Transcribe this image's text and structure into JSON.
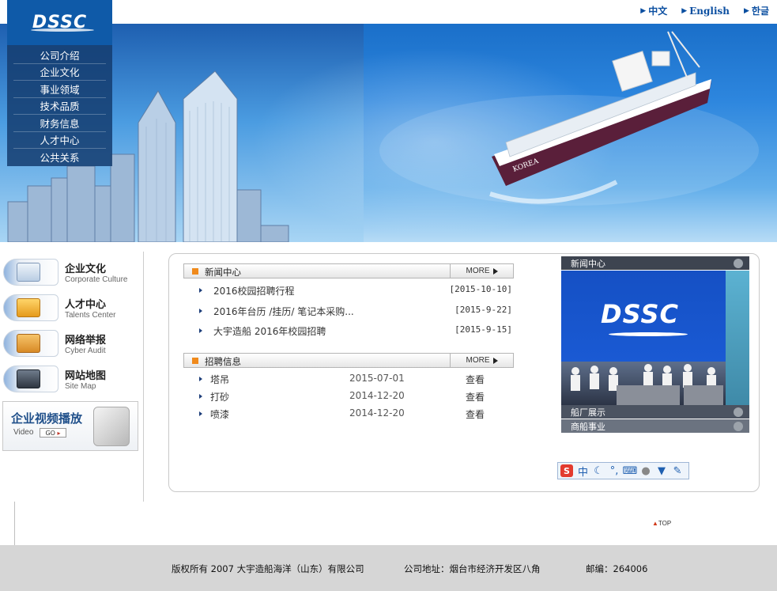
{
  "languages": [
    "中文",
    "English",
    "한글"
  ],
  "logo": {
    "text": "DSSC"
  },
  "nav": [
    "公司介绍",
    "企业文化",
    "事业领域",
    "技术品质",
    "财务信息",
    "人才中心",
    "公共关系"
  ],
  "side_links": [
    {
      "title": "企业文化",
      "subtitle": "Corporate Culture",
      "icon": "monitor-icon"
    },
    {
      "title": "人才中心",
      "subtitle": "Talents Center",
      "icon": "books-icon"
    },
    {
      "title": "网络举报",
      "subtitle": "Cyber Audit",
      "icon": "box-icon"
    },
    {
      "title": "网站地图",
      "subtitle": "Site Map",
      "icon": "computer-icon"
    }
  ],
  "video": {
    "title": "企业视频播放",
    "subtitle": "Video",
    "go": "GO"
  },
  "news": {
    "title": "新闻中心",
    "more": "MORE",
    "items": [
      {
        "title": "2016校园招聘行程",
        "date": "[2015-10-10]"
      },
      {
        "title": "2016年台历 /挂历/ 笔记本采购...",
        "date": "[2015-9-22]"
      },
      {
        "title": "大宇造船 2016年校园招聘",
        "date": "[2015-9-15]"
      }
    ]
  },
  "jobs": {
    "title": "招聘信息",
    "more": "MORE",
    "items": [
      {
        "title": "塔吊",
        "date": "2015-07-01",
        "action": "查看"
      },
      {
        "title": "打砂",
        "date": "2014-12-20",
        "action": "查看"
      },
      {
        "title": "喷漆",
        "date": "2014-12-20",
        "action": "查看"
      }
    ]
  },
  "photo_panel": {
    "top_label": "新闻中心",
    "image_text": "DSSC",
    "bottom_labels": [
      "船厂展示",
      "商船事业"
    ]
  },
  "ime": {
    "mode": "中"
  },
  "top_link": "TOP",
  "footer": {
    "copyright": "版权所有 2007 大宇造船海洋（山东）有限公司",
    "address": "公司地址：烟台市经济开发区八角",
    "postcode": "邮编：264006"
  },
  "colors": {
    "brand_blue": "#0f5aa8",
    "accent_orange": "#f08a1c",
    "footer_gray": "#d6d6d6"
  }
}
